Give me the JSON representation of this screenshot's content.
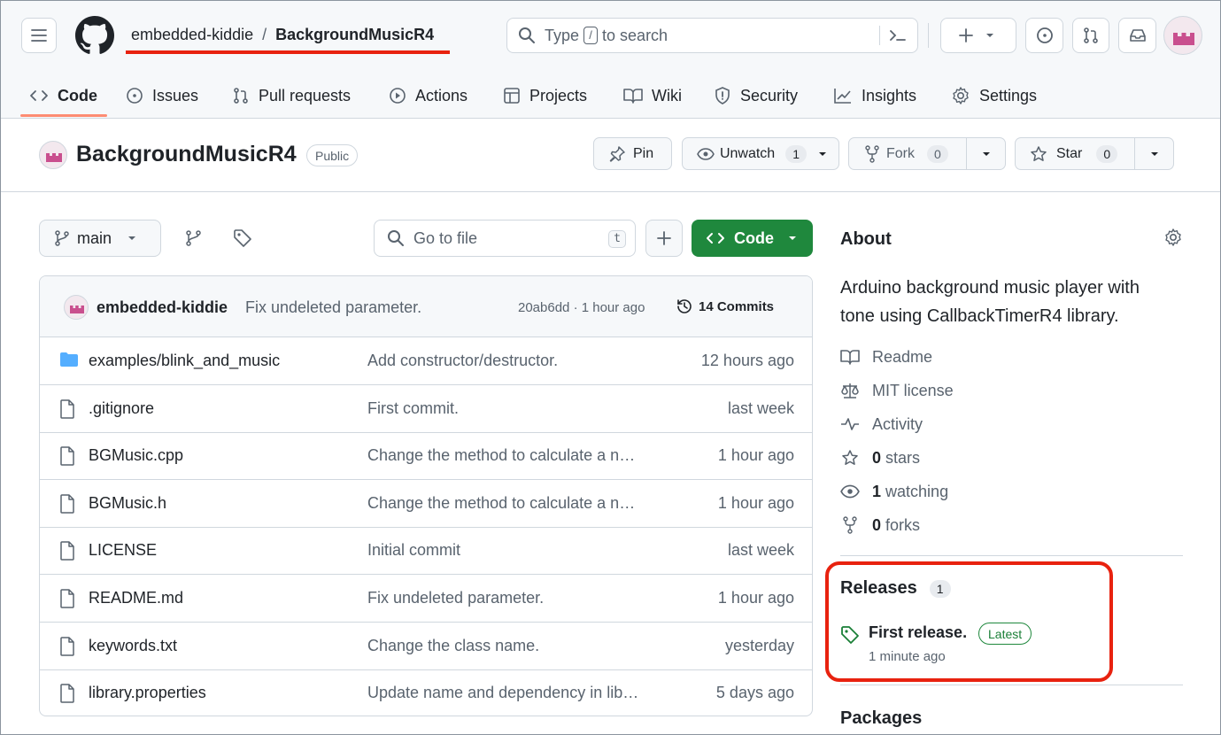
{
  "header": {
    "owner": "embedded-kiddie",
    "separator": "/",
    "repo": "BackgroundMusicR4",
    "search_prefix": "Type",
    "search_key": "/",
    "search_suffix": "to search",
    "icons": [
      "hamburger-icon",
      "github-logo-icon",
      "search-icon",
      "command-palette-icon",
      "plus-icon",
      "issues-icon",
      "pull-request-icon",
      "inbox-icon"
    ]
  },
  "tabs": [
    {
      "label": "Code",
      "icon": "code-icon"
    },
    {
      "label": "Issues",
      "icon": "issues-icon"
    },
    {
      "label": "Pull requests",
      "icon": "pull-request-icon"
    },
    {
      "label": "Actions",
      "icon": "play-icon"
    },
    {
      "label": "Projects",
      "icon": "table-icon"
    },
    {
      "label": "Wiki",
      "icon": "book-icon"
    },
    {
      "label": "Security",
      "icon": "shield-icon"
    },
    {
      "label": "Insights",
      "icon": "graph-icon"
    },
    {
      "label": "Settings",
      "icon": "gear-icon"
    }
  ],
  "repo_header": {
    "name": "BackgroundMusicR4",
    "visibility": "Public",
    "pin_label": "Pin",
    "unwatch_label": "Unwatch",
    "watch_count": "1",
    "fork_label": "Fork",
    "fork_count": "0",
    "star_label": "Star",
    "star_count": "0"
  },
  "toolbar": {
    "branch": "main",
    "go_to_file": "Go to file",
    "go_to_file_key": "t",
    "code_label": "Code"
  },
  "latest_commit": {
    "author": "embedded-kiddie",
    "message": "Fix undeleted parameter.",
    "meta": "20ab6dd · 1 hour ago",
    "commits": "14 Commits"
  },
  "files": [
    {
      "name": "examples/blink_and_music",
      "type": "folder",
      "message": "Add constructor/destructor.",
      "time": "12 hours ago"
    },
    {
      "name": ".gitignore",
      "type": "file",
      "message": "First commit.",
      "time": "last week"
    },
    {
      "name": "BGMusic.cpp",
      "type": "file",
      "message": "Change the method to calculate a n…",
      "time": "1 hour ago"
    },
    {
      "name": "BGMusic.h",
      "type": "file",
      "message": "Change the method to calculate a n…",
      "time": "1 hour ago"
    },
    {
      "name": "LICENSE",
      "type": "file",
      "message": "Initial commit",
      "time": "last week"
    },
    {
      "name": "README.md",
      "type": "file",
      "message": "Fix undeleted parameter.",
      "time": "1 hour ago"
    },
    {
      "name": "keywords.txt",
      "type": "file",
      "message": "Change the class name.",
      "time": "yesterday"
    },
    {
      "name": "library.properties",
      "type": "file",
      "message": "Update name and dependency in lib…",
      "time": "5 days ago"
    }
  ],
  "about": {
    "title": "About",
    "description": "Arduino background music player with tone using CallbackTimerR4 library.",
    "readme": "Readme",
    "license": "MIT license",
    "activity": "Activity",
    "stars_count": "0",
    "stars_label": "stars",
    "watching_count": "1",
    "watching_label": "watching",
    "forks_count": "0",
    "forks_label": "forks"
  },
  "releases": {
    "title": "Releases",
    "count": "1",
    "latest_name": "First release.",
    "latest_badge": "Latest",
    "latest_time": "1 minute ago"
  },
  "packages": {
    "title": "Packages"
  },
  "colors": {
    "accent_green": "#1f883d",
    "highlight_red": "#e8220f",
    "tab_underline": "#fd8c73"
  }
}
